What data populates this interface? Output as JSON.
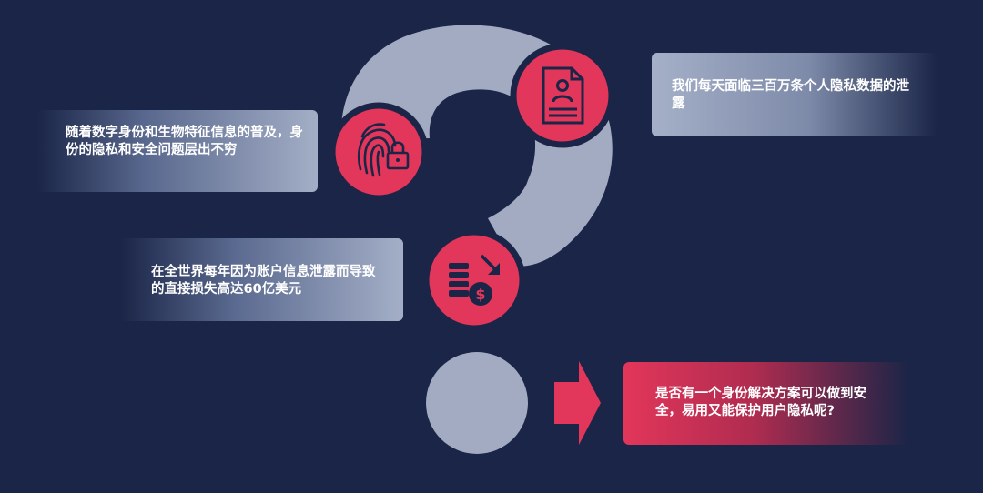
{
  "cards": {
    "biometric": "随着数字身份和生物特征信息的普及，身份的隐私和安全问题层出不穷",
    "loss": "在全世界每年因为账户信息泄露而导致的直接损失高达60亿美元",
    "daily_leaks": "我们每天面临三百万条个人隐私数据的泄露",
    "question": "是否有一个身份解决方案可以做到安全，易用又能保护用户隐私呢?"
  },
  "icons": {
    "top_circle": "document-profile-icon",
    "left_circle": "fingerprint-lock-icon",
    "bottom_circle": "coins-dollar-down-icon",
    "arrow": "arrow-right-icon"
  },
  "colors": {
    "background": "#1a2547",
    "question_mark": "#a3abc3",
    "accent": "#e2365a"
  }
}
